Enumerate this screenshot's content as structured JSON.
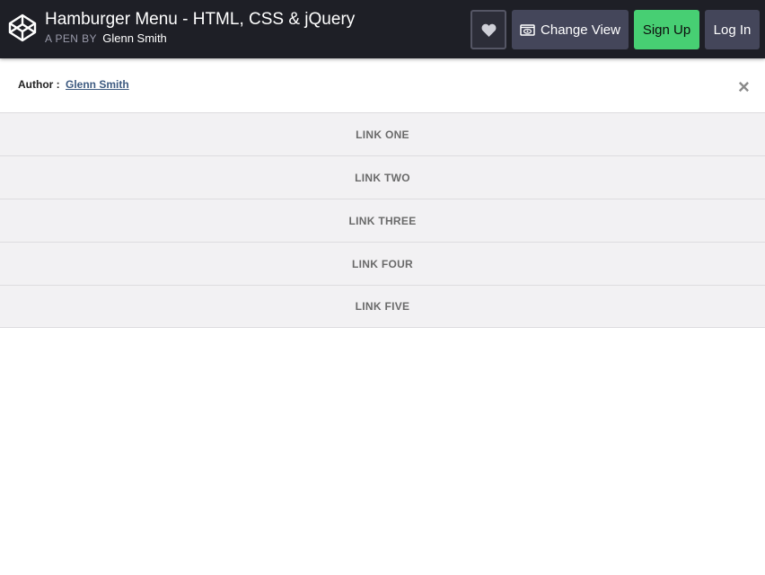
{
  "header": {
    "title": "Hamburger Menu - HTML, CSS & jQuery",
    "by_label": "A PEN BY",
    "author": "Glenn Smith",
    "logo_icon": "codepen-logo-icon",
    "heart_icon": "heart-icon",
    "change_view_label": "Change View",
    "change_view_icon": "eye-window-icon",
    "sign_up_label": "Sign Up",
    "log_in_label": "Log In",
    "colors": {
      "bar": "#1e1f26",
      "button": "#44465a",
      "sign_up": "#47cf73"
    }
  },
  "content": {
    "author_label": "Author :",
    "author_name": "Glenn Smith",
    "close_symbol": "×",
    "menu_items": [
      {
        "label": "LINK ONE"
      },
      {
        "label": "LINK TWO"
      },
      {
        "label": "LINK THREE"
      },
      {
        "label": "LINK FOUR"
      },
      {
        "label": "LINK FIVE"
      }
    ]
  }
}
